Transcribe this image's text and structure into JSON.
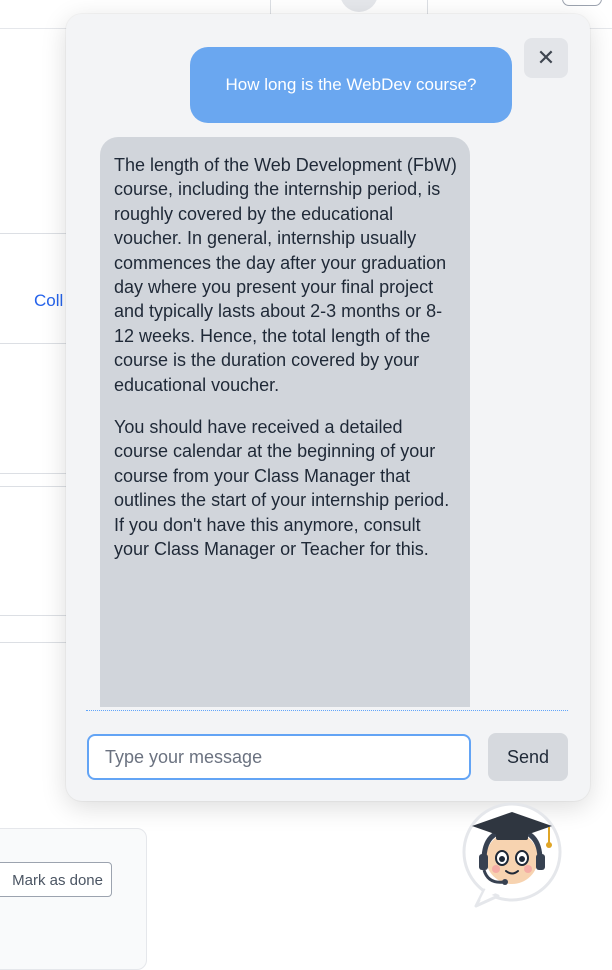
{
  "background": {
    "collapse_link": "Coll",
    "mark_done_label": "Mark as done"
  },
  "chat": {
    "user_message": "How long is the WebDev course?",
    "bot_message": {
      "paragraphs": [
        "The length of the Web Development (FbW) course, including the internship period, is roughly covered by the educational voucher. In general, internship usually commences the day after your graduation day where you present your final project and typically lasts about 2-3 months or 8-12 weeks. Hence, the total length of the course is the duration covered by your educational voucher.",
        "You should have received a detailed course calendar at the beginning of your course from your Class Manager that outlines the start of your internship period. If you don't have this anymore, consult your Class Manager or Teacher for this."
      ]
    },
    "close_icon": "close-icon",
    "input": {
      "placeholder": "Type your message",
      "value": ""
    },
    "send_label": "Send"
  },
  "avatar": {
    "icon": "graduate-bot-avatar-icon"
  },
  "colors": {
    "user_bubble": "#6aa7f0",
    "bot_bubble": "#d1d5db",
    "panel": "#f3f4f6",
    "input_border": "#63a4f5",
    "link": "#2563eb"
  }
}
